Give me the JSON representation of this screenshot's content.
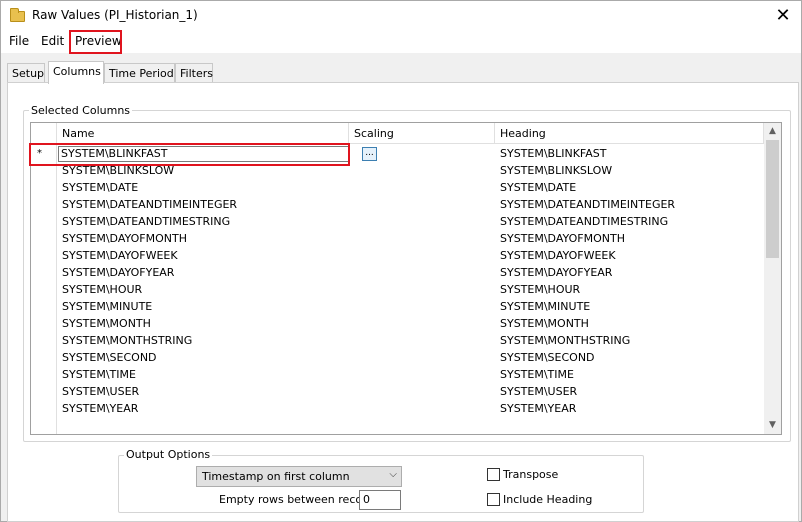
{
  "window": {
    "title": "Raw Values (PI_Historian_1)",
    "close_glyph": "✕",
    "folder_icon": "folder-icon"
  },
  "menu": {
    "file": "File",
    "edit": "Edit",
    "preview": "Preview"
  },
  "tabs": [
    {
      "label": "Setup",
      "active": false
    },
    {
      "label": "Columns",
      "active": true
    },
    {
      "label": "Time Period",
      "active": false
    },
    {
      "label": "Filters",
      "active": false
    }
  ],
  "selected_columns": {
    "group_label": "Selected Columns",
    "headers": {
      "name": "Name",
      "scaling": "Scaling",
      "heading": "Heading"
    },
    "new_row_marker": "*",
    "edit_value": "SYSTEM\\BLINKFAST",
    "ellipsis_label": "...",
    "rows": [
      {
        "name": "SYSTEM\\BLINKFAST",
        "scaling": "",
        "heading": "SYSTEM\\BLINKFAST"
      },
      {
        "name": "SYSTEM\\BLINKSLOW",
        "scaling": "",
        "heading": "SYSTEM\\BLINKSLOW"
      },
      {
        "name": "SYSTEM\\DATE",
        "scaling": "",
        "heading": "SYSTEM\\DATE"
      },
      {
        "name": "SYSTEM\\DATEANDTIMEINTEGER",
        "scaling": "",
        "heading": "SYSTEM\\DATEANDTIMEINTEGER"
      },
      {
        "name": "SYSTEM\\DATEANDTIMESTRING",
        "scaling": "",
        "heading": "SYSTEM\\DATEANDTIMESTRING"
      },
      {
        "name": "SYSTEM\\DAYOFMONTH",
        "scaling": "",
        "heading": "SYSTEM\\DAYOFMONTH"
      },
      {
        "name": "SYSTEM\\DAYOFWEEK",
        "scaling": "",
        "heading": "SYSTEM\\DAYOFWEEK"
      },
      {
        "name": "SYSTEM\\DAYOFYEAR",
        "scaling": "",
        "heading": "SYSTEM\\DAYOFYEAR"
      },
      {
        "name": "SYSTEM\\HOUR",
        "scaling": "",
        "heading": "SYSTEM\\HOUR"
      },
      {
        "name": "SYSTEM\\MINUTE",
        "scaling": "",
        "heading": "SYSTEM\\MINUTE"
      },
      {
        "name": "SYSTEM\\MONTH",
        "scaling": "",
        "heading": "SYSTEM\\MONTH"
      },
      {
        "name": "SYSTEM\\MONTHSTRING",
        "scaling": "",
        "heading": "SYSTEM\\MONTHSTRING"
      },
      {
        "name": "SYSTEM\\SECOND",
        "scaling": "",
        "heading": "SYSTEM\\SECOND"
      },
      {
        "name": "SYSTEM\\TIME",
        "scaling": "",
        "heading": "SYSTEM\\TIME"
      },
      {
        "name": "SYSTEM\\USER",
        "scaling": "",
        "heading": "SYSTEM\\USER"
      },
      {
        "name": "SYSTEM\\YEAR",
        "scaling": "",
        "heading": "SYSTEM\\YEAR"
      }
    ]
  },
  "output_options": {
    "group_label": "Output Options",
    "timestamp_select": "Timestamp on first column",
    "empty_rows_label": "Empty rows between records",
    "empty_rows_value": "0",
    "transpose_label": "Transpose",
    "transpose_checked": false,
    "include_heading_label": "Include Heading",
    "include_heading_checked": false
  },
  "colors": {
    "highlight": "#e0141e",
    "panel_bg": "#ffffff",
    "window_bg": "#f0f0f0"
  }
}
